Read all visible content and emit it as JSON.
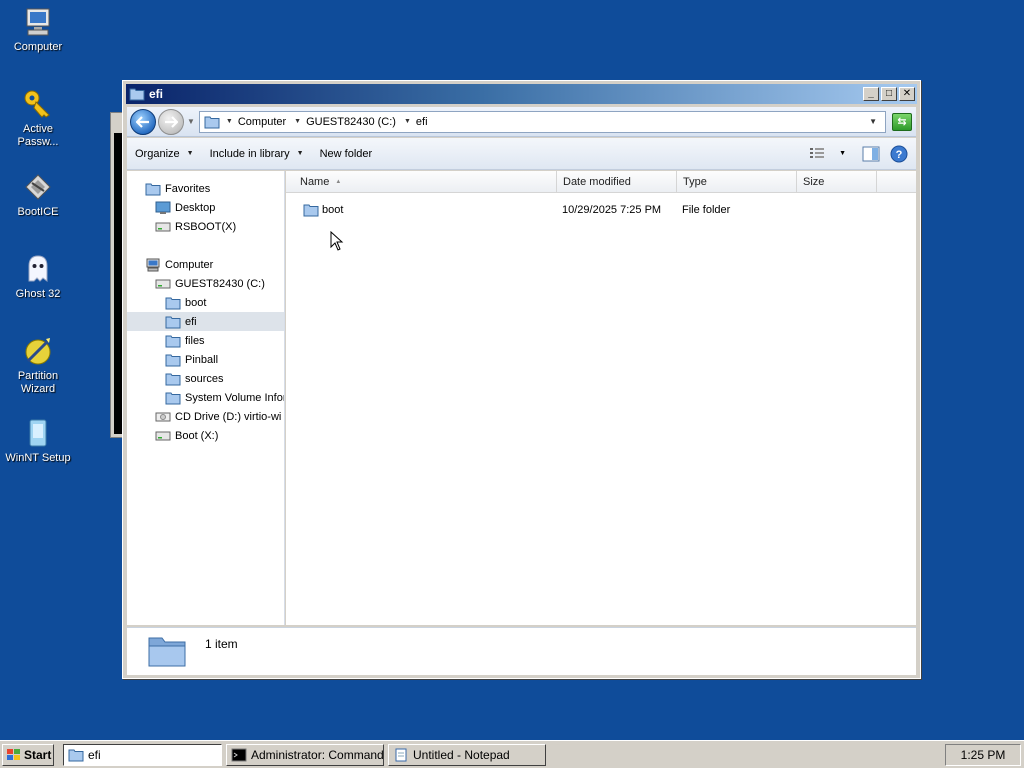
{
  "desktop": {
    "icons": [
      {
        "label": "Computer",
        "icon": "computer-icon"
      },
      {
        "label": "Active Passw...",
        "icon": "key-icon"
      },
      {
        "label": "BootICE",
        "icon": "bootice-icon"
      },
      {
        "label": "Ghost 32",
        "icon": "ghost-icon"
      },
      {
        "label": "Partition Wizard",
        "icon": "partition-wizard-icon"
      },
      {
        "label": "WinNT Setup",
        "icon": "winnt-setup-icon"
      }
    ]
  },
  "window": {
    "title": "efi",
    "minimize": "_",
    "maximize": "□",
    "close": "✕"
  },
  "address": {
    "crumbs": [
      "Computer",
      "GUEST82430 (C:)",
      "efi"
    ]
  },
  "toolbar": {
    "organize": "Organize",
    "include_in_library": "Include in library",
    "new_folder": "New folder"
  },
  "navpane": {
    "items": [
      {
        "label": "Favorites",
        "icon": "favorites-icon",
        "level": 1
      },
      {
        "label": "Desktop",
        "icon": "desktop-icon",
        "level": 2
      },
      {
        "label": "RSBOOT(X)",
        "icon": "drive-icon",
        "level": 2
      },
      {
        "label": "Computer",
        "icon": "computer-icon",
        "level": 1
      },
      {
        "label": "GUEST82430 (C:)",
        "icon": "drive-icon",
        "level": 2
      },
      {
        "label": "boot",
        "icon": "folder-icon",
        "level": 3
      },
      {
        "label": "efi",
        "icon": "folder-icon",
        "level": 3,
        "selected": true
      },
      {
        "label": "files",
        "icon": "folder-icon",
        "level": 3
      },
      {
        "label": "Pinball",
        "icon": "folder-icon",
        "level": 3
      },
      {
        "label": "sources",
        "icon": "folder-icon",
        "level": 3
      },
      {
        "label": "System Volume Infor",
        "icon": "folder-icon",
        "level": 3
      },
      {
        "label": "CD Drive (D:) virtio-wi",
        "icon": "cd-drive-icon",
        "level": 2
      },
      {
        "label": "Boot (X:)",
        "icon": "drive-icon",
        "level": 2
      }
    ]
  },
  "filelist": {
    "columns": [
      "Name",
      "Date modified",
      "Type",
      "Size"
    ],
    "rows": [
      {
        "name": "boot",
        "date_modified": "10/29/2025 7:25 PM",
        "type": "File folder",
        "size": ""
      }
    ]
  },
  "details": {
    "item_count": "1 item"
  },
  "taskbar": {
    "start": "Start",
    "tasks": [
      {
        "label": "efi",
        "active": true
      },
      {
        "label": "Administrator: Command...",
        "active": false
      },
      {
        "label": "Untitled - Notepad",
        "active": false
      }
    ],
    "clock": "1:25 PM"
  },
  "colors": {
    "desktop_bg": "#0f4c9a",
    "title_active": "#0a246a",
    "selection": "#dde3ea"
  }
}
